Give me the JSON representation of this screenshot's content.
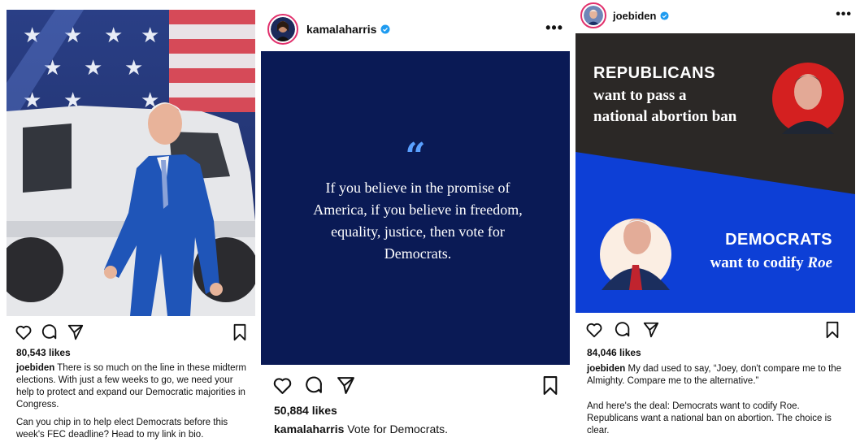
{
  "post1": {
    "likes": "80,543 likes",
    "username": "joebiden",
    "caption_part1": "There is so much on the line in these midterm elections. With just a few weeks to go, we need your help to protect and expand our Democratic majorities in Congress.",
    "caption_part2": "Can you chip in to help elect Democrats before this week's FEC deadline? Head to my link in bio.",
    "image_icon": "photo-biden-walking-icon"
  },
  "post2": {
    "username": "kamalaharris",
    "more_label": "•••",
    "quote_mark": "“",
    "quote_text": "If you believe in the promise of America, if you believe in freedom, equality, justice, then vote for Democrats.",
    "likes": "50,884 likes",
    "caption_user": "kamalaharris",
    "caption_text": "Vote for Democrats.",
    "colors": {
      "quote_bg": "#0a1a55",
      "quote_mark": "#5aa0ff"
    }
  },
  "post3": {
    "username": "joebiden",
    "more_label": "•••",
    "graphic": {
      "top_heading": "REPUBLICANS",
      "top_sub1": "want to pass a",
      "top_sub2": "national abortion ban",
      "bottom_heading": "DEMOCRATS",
      "bottom_sub": "want to codify ",
      "bottom_sub_italic": "Roe",
      "colors": {
        "dark": "#2b2826",
        "blue": "#0d3fd6",
        "red": "#d42020"
      }
    },
    "likes": "84,046 likes",
    "caption_user": "joebiden",
    "caption_text": "My dad used to say, “Joey, don't compare me to the Almighty. Compare me to the alternative.”",
    "caption_part2": "And here's the deal: Democrats want to codify Roe. Republicans want a national ban on abortion. The choice is clear."
  }
}
